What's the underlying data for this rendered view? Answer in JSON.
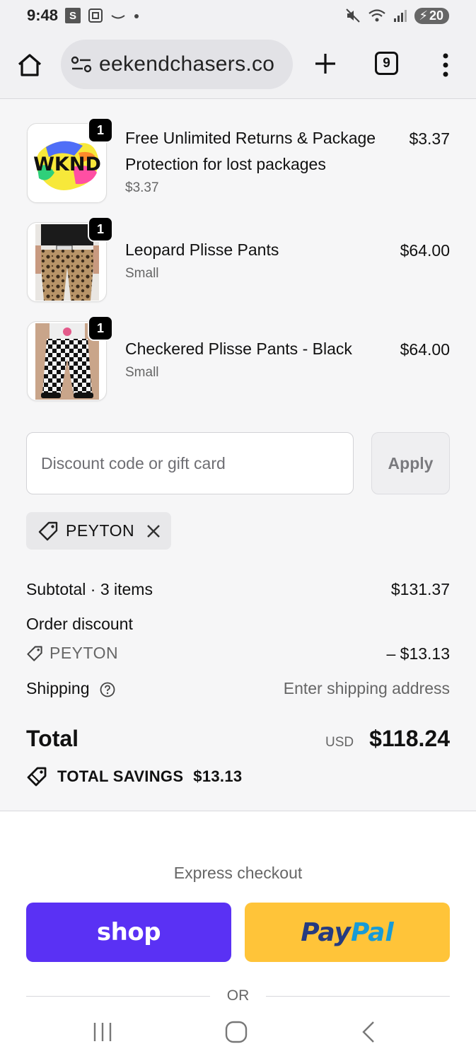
{
  "status_bar": {
    "time": "9:48",
    "badge": "S",
    "battery": "20"
  },
  "browser": {
    "url": "eekendchasers.co",
    "tab_count": "9"
  },
  "line_items": [
    {
      "quantity": "1",
      "name_line1": "Free Unlimited Returns & Package",
      "name_line2": "Protection for lost packages",
      "subtitle": "$3.37",
      "price": "$3.37",
      "thumb_text": "WKND"
    },
    {
      "quantity": "1",
      "name_line1": "Leopard Plisse Pants",
      "subtitle": "Small",
      "price": "$64.00"
    },
    {
      "quantity": "1",
      "name_line1": "Checkered Plisse Pants - Black",
      "subtitle": "Small",
      "price": "$64.00"
    }
  ],
  "discount": {
    "placeholder": "Discount code or gift card",
    "apply_label": "Apply",
    "applied_code": "PEYTON"
  },
  "summary": {
    "subtotal_label": "Subtotal · 3 items",
    "subtotal_value": "$131.37",
    "order_discount_label": "Order discount",
    "discount_code": "PEYTON",
    "discount_value": "– $13.13",
    "shipping_label": "Shipping",
    "shipping_value": "Enter shipping address",
    "total_label": "Total",
    "currency": "USD",
    "total_value": "$118.24",
    "savings_label": "TOTAL SAVINGS",
    "savings_value": "$13.13"
  },
  "express": {
    "title": "Express checkout",
    "shop_label": "shop",
    "paypal_pay": "Pay",
    "paypal_pal": "Pal",
    "or_label": "OR"
  },
  "colors": {
    "shop_purple": "#5a31f4",
    "paypal_yellow": "#ffc439",
    "paypal_dark_blue": "#253b80",
    "paypal_light_blue": "#179bd7"
  }
}
